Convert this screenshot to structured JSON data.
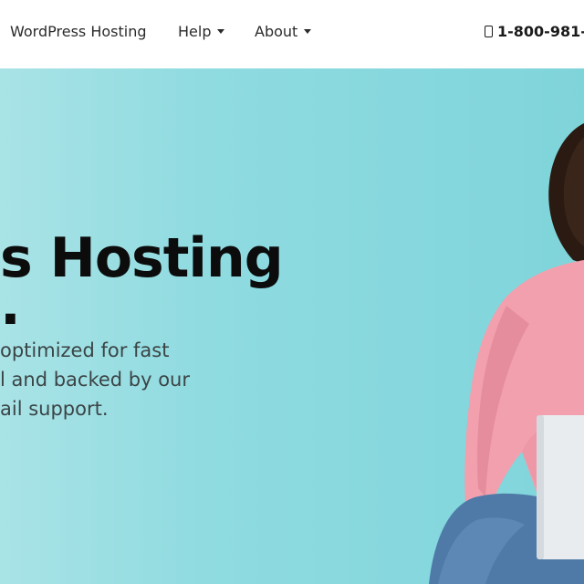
{
  "nav": {
    "items": [
      {
        "label": "WordPress Hosting",
        "has_dropdown": false
      },
      {
        "label": "Help",
        "has_dropdown": true
      },
      {
        "label": "About",
        "has_dropdown": true
      }
    ],
    "phone": "1-800-981-",
    "phone_icon": "phone-icon"
  },
  "hero": {
    "title": "s Hosting",
    "subtitle": ".",
    "body_lines": [
      "optimized for fast",
      "l and backed by our",
      "ail support."
    ],
    "background": "#8fdbe0",
    "title_color": "#0c0c0c"
  },
  "colors": {
    "sweater": "#f2a0ae",
    "jeans": "#4f7aa8",
    "hair": "#2a1a12",
    "laptop": "#e9ecef"
  }
}
